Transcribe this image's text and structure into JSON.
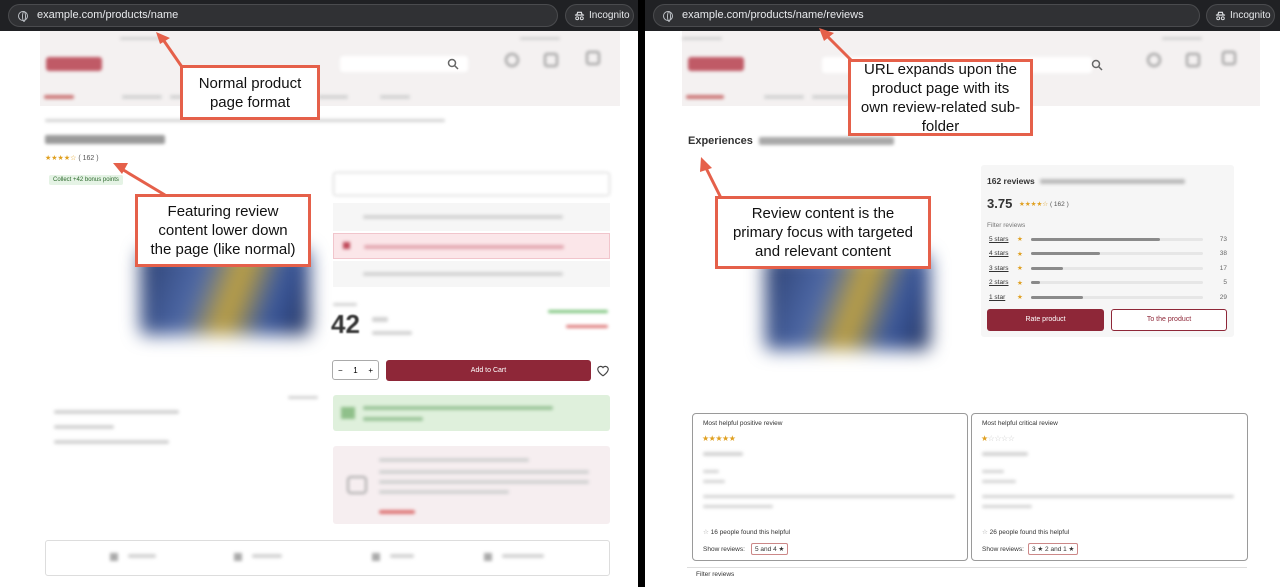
{
  "left": {
    "browser": {
      "url": "example.com/products/name",
      "incognito_label": "Incognito"
    },
    "product": {
      "review_count": "( 162 )",
      "bonus_badge": "Collect +42 bonus points",
      "price_main": "42",
      "quantity": "1",
      "add_to_cart": "Add to Cart"
    },
    "callouts": {
      "top": "Normal product page format",
      "bottom": "Featuring review content lower down the page (like normal)"
    }
  },
  "right": {
    "browser": {
      "url": "example.com/products/name/reviews",
      "incognito_label": "Incognito"
    },
    "page_title": "Experiences",
    "summary": {
      "count_label": "162 reviews",
      "average": "3.75",
      "average_count": "( 162 )",
      "filter_label": "Filter reviews",
      "rows": [
        {
          "label": "5 stars",
          "count": "73",
          "fraction": 0.45
        },
        {
          "label": "4 stars",
          "count": "38",
          "fraction": 0.24
        },
        {
          "label": "3 stars",
          "count": "17",
          "fraction": 0.11
        },
        {
          "label": "2 stars",
          "count": "5",
          "fraction": 0.03
        },
        {
          "label": "1 star",
          "count": "29",
          "fraction": 0.18
        }
      ],
      "rate_button": "Rate product",
      "to_product_button": "To the product"
    },
    "positive_review": {
      "heading": "Most helpful positive review",
      "stars": "★★★★★",
      "helpful": "16 people found this helpful",
      "show_label": "Show reviews:",
      "filter_chip": "5 and 4 ★"
    },
    "critical_review": {
      "heading": "Most helpful critical review",
      "stars": "★☆☆☆☆",
      "helpful": "26 people found this helpful",
      "show_label": "Show reviews:",
      "filter_chip": "3 ★ 2 and 1 ★"
    },
    "footer_filter": "Filter reviews",
    "callouts": {
      "top": "URL expands upon the product page with its own review-related sub-folder",
      "middle": "Review content is the primary focus with targeted and relevant content"
    }
  },
  "colors": {
    "accent": "#8e2738",
    "callout_border": "#e5604a",
    "star": "#e0a020"
  }
}
